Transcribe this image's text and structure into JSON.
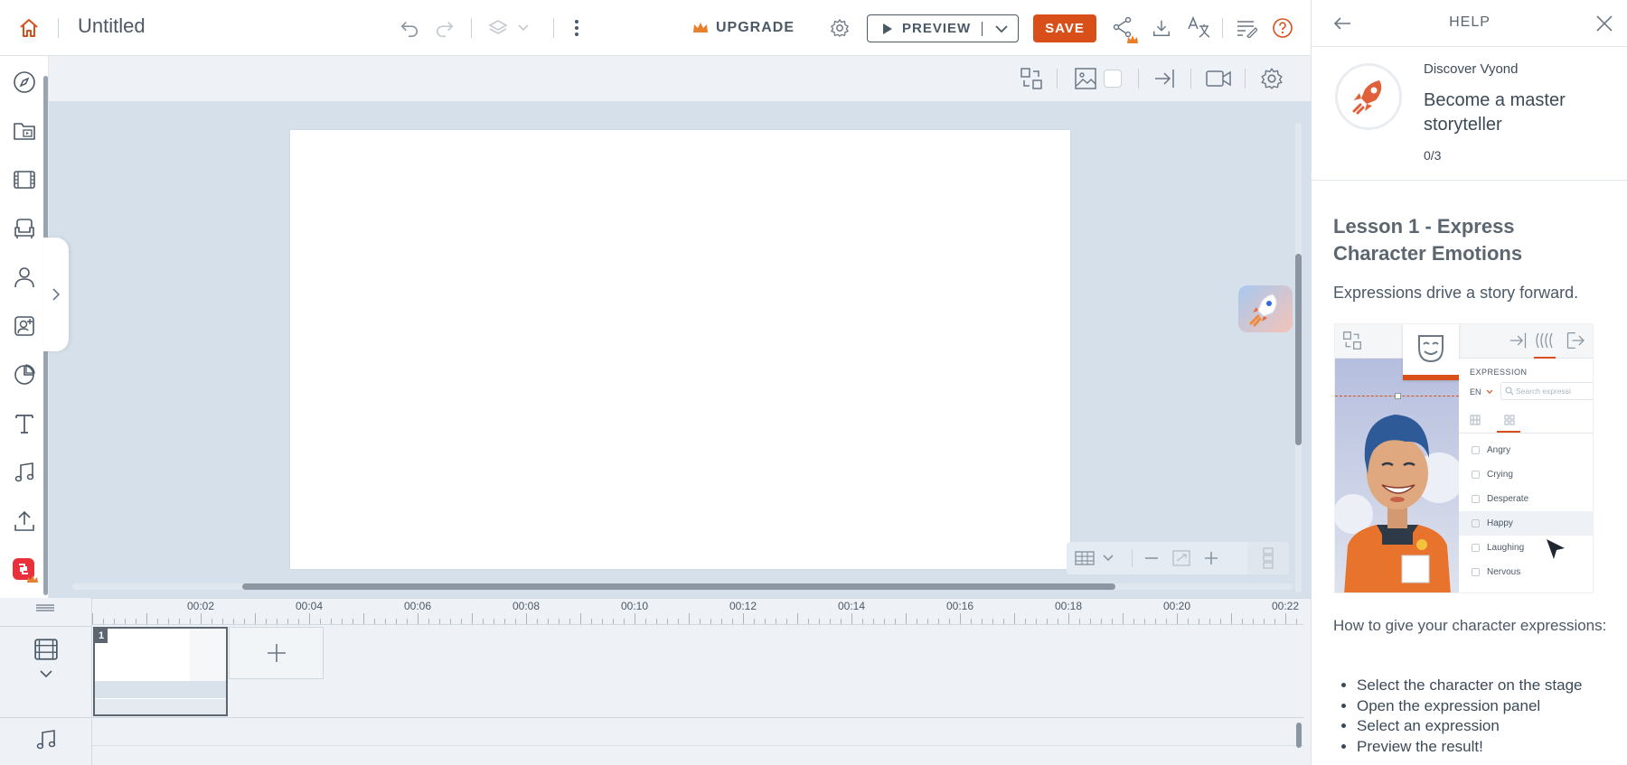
{
  "topbar": {
    "title": "Untitled",
    "upgrade_label": "UPGRADE",
    "preview_label": "PREVIEW",
    "save_label": "SAVE"
  },
  "timeline": {
    "time_labels": [
      "00:02",
      "00:04",
      "00:06",
      "00:08",
      "00:10",
      "00:12",
      "00:14",
      "00:16",
      "00:18",
      "00:20",
      "00:22"
    ],
    "scene_number": "1"
  },
  "help": {
    "title": "HELP",
    "card_kicker": "Discover Vyond",
    "card_title": "Become a master storyteller",
    "progress": "0/3",
    "lesson_title": "Lesson 1 - Express Character Emotions",
    "lesson_subtitle": "Expressions drive a story forward.",
    "howto_intro": "How to give your character expressions:",
    "steps": [
      "Select the character on the stage",
      "Open the expression panel",
      "Select an expression",
      "Preview the result!"
    ],
    "illustration": {
      "panel_heading": "EXPRESSION",
      "lang": "EN",
      "search_placeholder": "Search expressi",
      "expressions": [
        "Angry",
        "Crying",
        "Desperate",
        "Happy",
        "Laughing",
        "Nervous"
      ],
      "selected_expression": "Happy"
    }
  },
  "colors": {
    "accent": "#d84f1a",
    "text": "#4b5866",
    "stage_bg": "#d6e0ea",
    "panel_bg": "#eef2f6"
  }
}
